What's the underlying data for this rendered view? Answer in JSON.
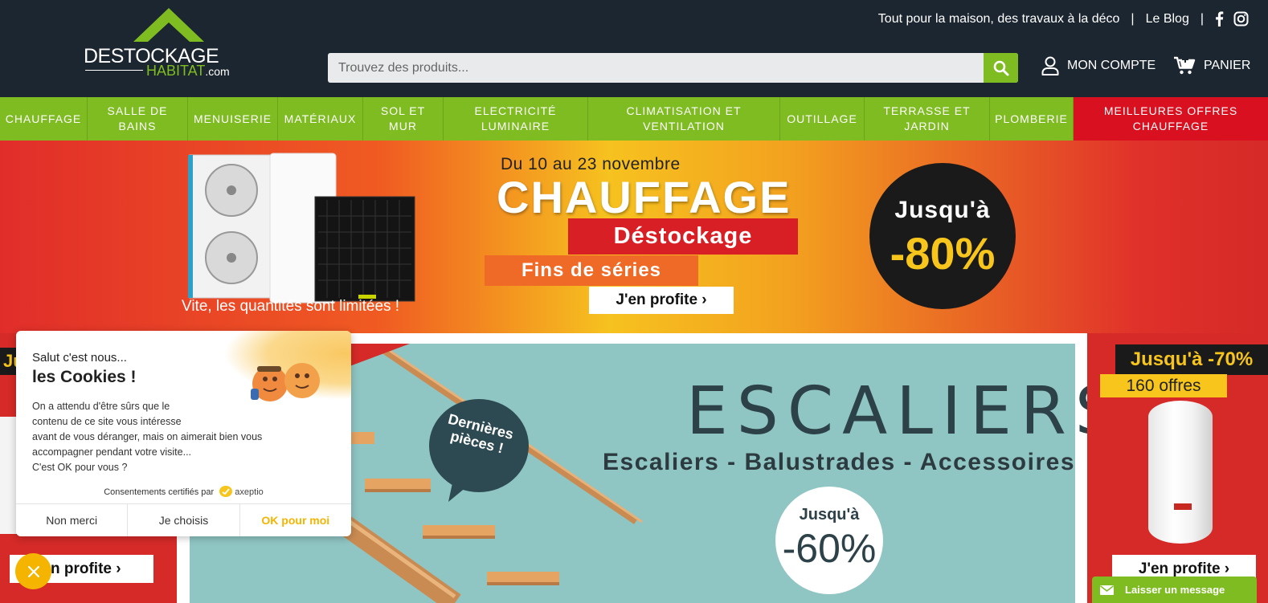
{
  "header": {
    "logo": {
      "word1": "DESTOCKAGE",
      "word2": "HABITAT",
      "word3": ".com"
    },
    "tagline": "Tout pour la maison, des travaux à la déco",
    "separator": "|",
    "blog_link": "Le Blog",
    "social": [
      "facebook-icon",
      "instagram-icon"
    ],
    "search": {
      "placeholder": "Trouvez des produits..."
    },
    "account_label": "MON COMPTE",
    "cart_label": "PANIER"
  },
  "nav": {
    "items": [
      {
        "label": "CHAUFFAGE"
      },
      {
        "label": "SALLE DE BAINS"
      },
      {
        "label": "MENUISERIE"
      },
      {
        "label": "MATÉRIAUX"
      },
      {
        "label": "SOL ET MUR"
      },
      {
        "label": "ELECTRICITÉ LUMINAIRE"
      },
      {
        "label": "CLIMATISATION ET VENTILATION"
      },
      {
        "label": "OUTILLAGE"
      },
      {
        "label": "TERRASSE ET JARDIN"
      },
      {
        "label": "PLOMBERIE"
      },
      {
        "label": "MEILLEURES OFFRES CHAUFFAGE"
      }
    ]
  },
  "hero": {
    "dates": "Du 10 au 23 novembre",
    "title": "CHAUFFAGE",
    "tag1": "Déstockage",
    "tag2": "Fins de séries",
    "cta": "J'en profite ›",
    "subtitle": "Vite, les quantités sont limitées !",
    "discount_prefix": "Jusqu'à",
    "discount_value": "-80%"
  },
  "left_banner": {
    "promo_partial": "Ju",
    "cta": "en profite ›"
  },
  "center_banner": {
    "bubble": "Dernières pièces !",
    "title": "ESCALIERS",
    "subtitle": "Escaliers - Balustrades - Accessoires",
    "discount_prefix": "Jusqu'à",
    "discount_value": "-60%"
  },
  "right_banner": {
    "promo": "Jusqu'à -70%",
    "offers": "160 offres",
    "cta": "J'en profite ›"
  },
  "cookie": {
    "greeting": "Salut c'est nous...",
    "title": "les Cookies !",
    "body_lines": [
      "On a attendu d'être sûrs que le",
      "contenu de ce site vous intéresse",
      "avant de vous déranger, mais on aimerait bien vous",
      "accompagner pendant votre visite...",
      "C'est OK pour vous ?"
    ],
    "certif_text": "Consentements certifiés par",
    "certif_brand": "axeptio",
    "btn_no": "Non merci",
    "btn_choose": "Je choisis",
    "btn_ok": "OK pour moi"
  },
  "chat": {
    "label": "Laisser un message"
  },
  "colors": {
    "header_bg": "#1c2631",
    "brand_green": "#7ebc21",
    "promo_red": "#d9101f",
    "accent_yellow": "#f7c51b",
    "cookie_accent": "#f4b400"
  }
}
